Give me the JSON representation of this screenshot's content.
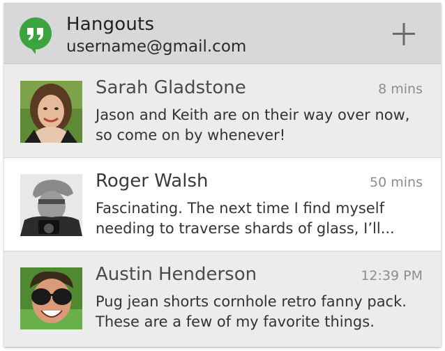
{
  "app": {
    "title": "Hangouts",
    "account": "username@gmail.com",
    "brand_color": "#3aa53f",
    "add_icon": "plus-icon"
  },
  "conversations": [
    {
      "name": "Sarah Gladstone",
      "time": "8 mins",
      "message_line1": "Jason and Keith are on their way over now,",
      "message_line2": "so come on by whenever!",
      "avatar": "avatar-photo",
      "highlighted": false
    },
    {
      "name": "Roger Walsh",
      "time": "50 mins",
      "message_line1": "Fascinating. The next time I find myself",
      "message_line2": "needing to traverse shards of glass, I’ll...",
      "avatar": "avatar-photo",
      "highlighted": true
    },
    {
      "name": "Austin Henderson",
      "time": "12:39 PM",
      "message_line1": "Pug jean shorts cornhole retro fanny pack.",
      "message_line2": "These are a few of my favorite things.",
      "avatar": "avatar-photo",
      "highlighted": false
    }
  ]
}
